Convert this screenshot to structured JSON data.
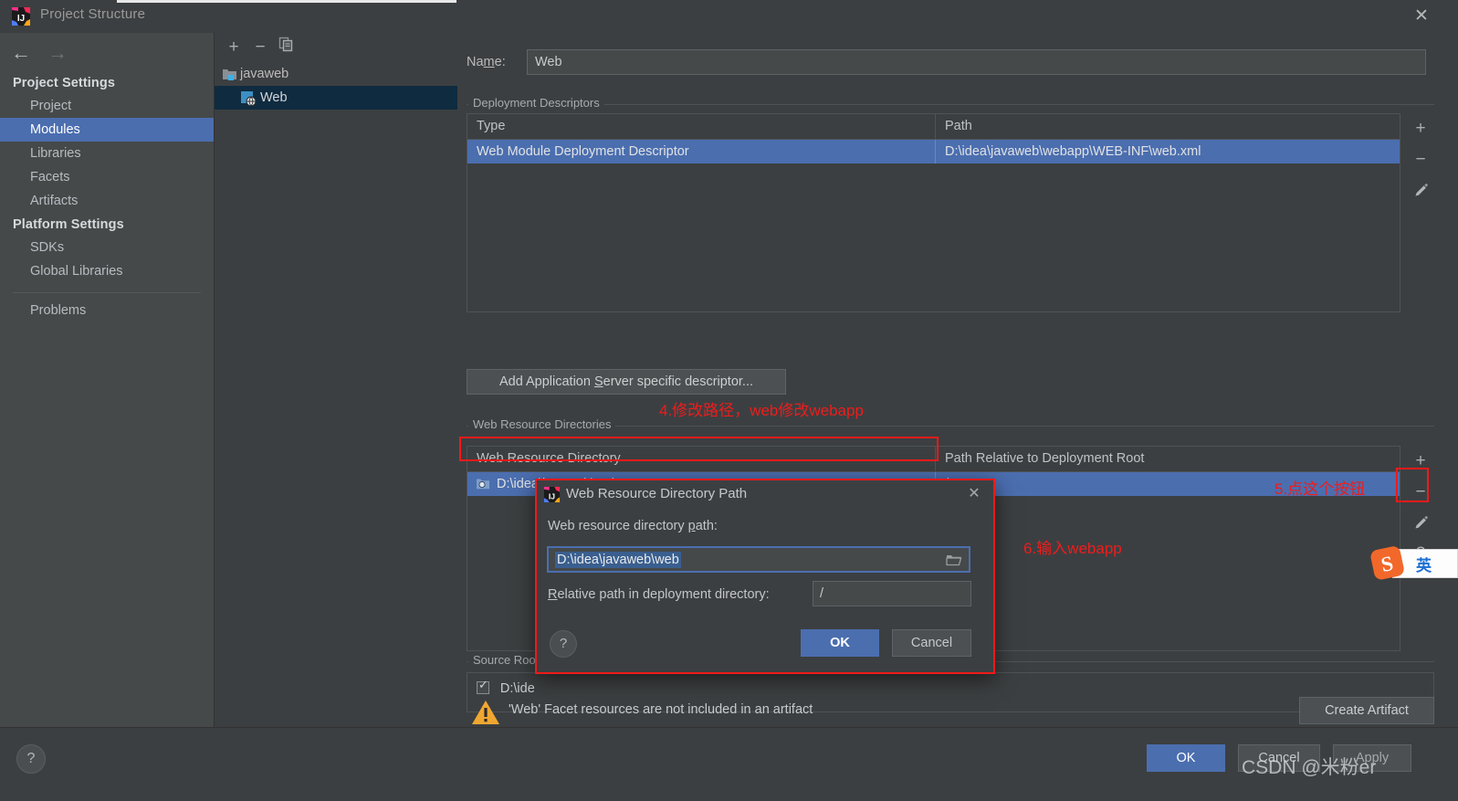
{
  "window": {
    "title": "Project Structure",
    "close_label": "✕",
    "app_icon": "intellij-idea-icon"
  },
  "sidebar": {
    "nav": {
      "back": "←",
      "forward": "→"
    },
    "groups": [
      {
        "label": "Project Settings",
        "items": [
          {
            "label": "Project",
            "selected": false
          },
          {
            "label": "Modules",
            "selected": true
          },
          {
            "label": "Libraries",
            "selected": false
          },
          {
            "label": "Facets",
            "selected": false
          },
          {
            "label": "Artifacts",
            "selected": false
          }
        ]
      },
      {
        "label": "Platform Settings",
        "items": [
          {
            "label": "SDKs",
            "selected": false
          },
          {
            "label": "Global Libraries",
            "selected": false
          }
        ]
      }
    ],
    "problems": "Problems"
  },
  "module_panel": {
    "toolbar": {
      "add": "+",
      "remove": "−",
      "copy": "copy-icon"
    },
    "tree": [
      {
        "label": "javaweb",
        "icon": "module-folder-icon",
        "selected": false,
        "indent": 0
      },
      {
        "label": "Web",
        "icon": "web-facet-icon",
        "selected": true,
        "indent": 1
      }
    ]
  },
  "main": {
    "name_label": "Name:",
    "name_value": "Web",
    "deployment_descriptors": {
      "group_title": "Deployment Descriptors",
      "columns": [
        "Type",
        "Path"
      ],
      "rows": [
        {
          "type": "Web Module Deployment Descriptor",
          "path": "D:\\idea\\javaweb\\webapp\\WEB-INF\\web.xml",
          "selected": true
        }
      ],
      "side_buttons": [
        "+",
        "−",
        "pencil-edit-icon"
      ]
    },
    "add_descriptor_button": "Add Application Server specific descriptor...",
    "web_resource_directories": {
      "group_title": "Web Resource Directories",
      "columns": [
        "Web Resource Directory",
        "Path Relative to Deployment Root"
      ],
      "rows": [
        {
          "directory": "D:\\idea\\javaweb\\web",
          "relative": "/",
          "selected": true
        }
      ],
      "side_buttons": [
        "+",
        "−",
        "pencil-edit-icon",
        "?"
      ]
    },
    "source_root": {
      "group_title": "Source Root",
      "rows": [
        {
          "label": "D:\\ide",
          "checked": true
        }
      ]
    },
    "warning": {
      "icon": "warning-triangle-icon",
      "text": "'Web' Facet resources are not included in an artifact",
      "action_button": "Create Artifact"
    }
  },
  "footer": {
    "help": "?",
    "ok": "OK",
    "cancel": "Cancel",
    "apply": "Apply"
  },
  "dialog": {
    "title": "Web Resource Directory Path",
    "icon": "intellij-idea-icon",
    "close_label": "✕",
    "path_label_pre": "Web resource directory ",
    "path_label_key": "p",
    "path_label_post": "ath:",
    "path_value": "D:\\idea\\javaweb\\web",
    "folder_icon": "folder-browse-icon",
    "relative_label_key": "R",
    "relative_label_post": "elative path in deployment directory:",
    "relative_value": "/",
    "help": "?",
    "ok": "OK",
    "cancel": "Cancel"
  },
  "annotations": [
    {
      "id": "ann4",
      "text": "4.修改路径，web修改webapp"
    },
    {
      "id": "ann5",
      "text": "5.点这个按钮"
    },
    {
      "id": "ann6",
      "text": "6.输入webapp"
    }
  ],
  "ime": {
    "logo": "sogou-logo-icon",
    "mode": "英"
  },
  "watermark": "CSDN @米粉er",
  "colors": {
    "accent_blue": "#4b6eaf",
    "annotation_red": "#ee1c1c",
    "panel_bg": "#3c3f41",
    "sidebar_bg": "#45494a",
    "tree_selection": "#0f2b40",
    "warning_orange": "#f0a732"
  }
}
